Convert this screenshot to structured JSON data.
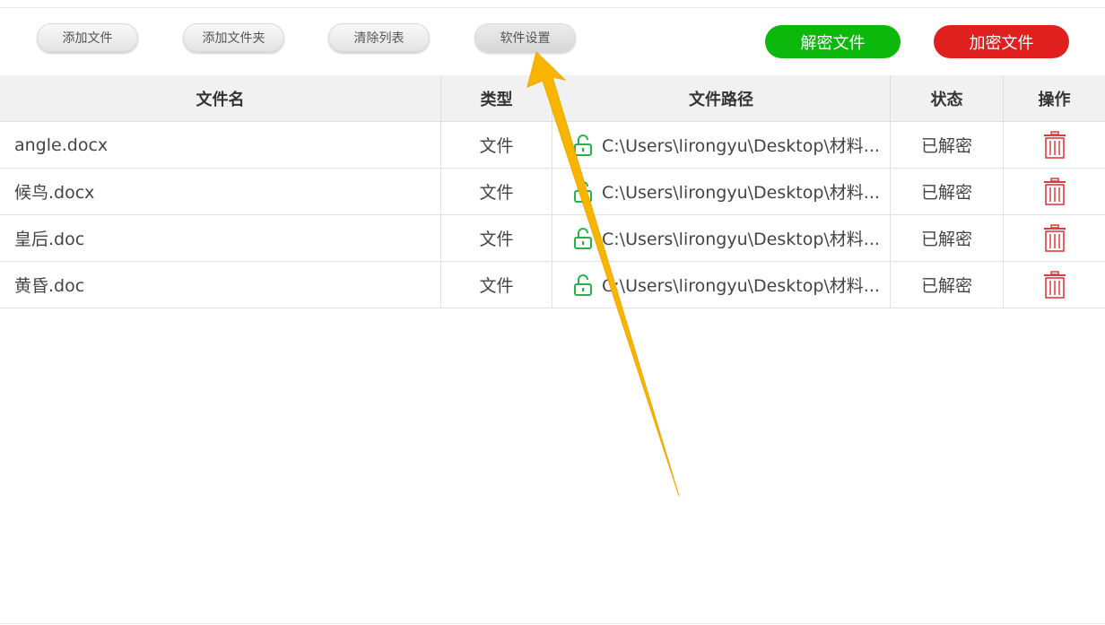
{
  "toolbar": {
    "add_file": "添加文件",
    "add_folder": "添加文件夹",
    "clear_list": "清除列表",
    "settings": "软件设置",
    "decrypt": "解密文件",
    "encrypt": "加密文件"
  },
  "colors": {
    "decrypt": "#0cb80c",
    "encrypt": "#e0201e",
    "unlock_icon": "#22b34a",
    "trash_icon": "#e03a3a",
    "arrow": "#f7b500"
  },
  "table": {
    "headers": [
      "文件名",
      "类型",
      "文件路径",
      "状态",
      "操作"
    ],
    "rows": [
      {
        "name": "angle.docx",
        "type": "文件",
        "path": "C:\\Users\\lirongyu\\Desktop\\材料...",
        "status": "已解密",
        "lock_icon": "unlock-icon",
        "action_icon": "trash-icon"
      },
      {
        "name": "候鸟.docx",
        "type": "文件",
        "path": "C:\\Users\\lirongyu\\Desktop\\材料...",
        "status": "已解密",
        "lock_icon": "unlock-icon",
        "action_icon": "trash-icon"
      },
      {
        "name": "皇后.doc",
        "type": "文件",
        "path": "C:\\Users\\lirongyu\\Desktop\\材料...",
        "status": "已解密",
        "lock_icon": "unlock-icon",
        "action_icon": "trash-icon"
      },
      {
        "name": "黄昏.doc",
        "type": "文件",
        "path": "C:\\Users\\lirongyu\\Desktop\\材料...",
        "status": "已解密",
        "lock_icon": "unlock-icon",
        "action_icon": "trash-icon"
      }
    ]
  },
  "annotation": {
    "icon": "arrow-pointer-icon",
    "target": "settings"
  }
}
